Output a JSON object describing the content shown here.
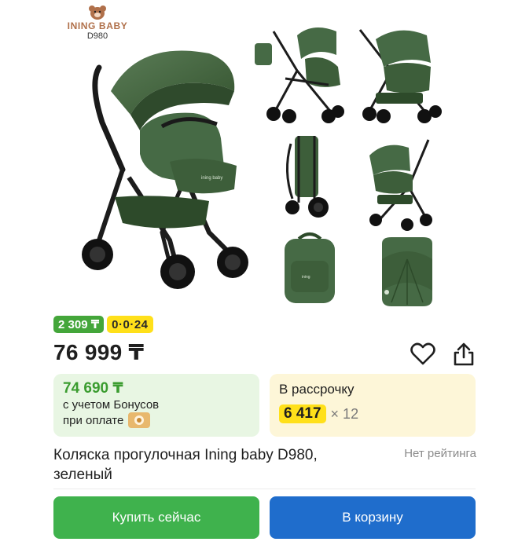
{
  "brand": {
    "name": "INING BABY",
    "model": "D980"
  },
  "gallery": {
    "main_image": "stroller-main-photo",
    "thumbnails": [
      "stroller-with-bag",
      "stroller-reversed-seat",
      "stroller-folded",
      "stroller-bassinet",
      "backpack",
      "footmuff"
    ],
    "product_color": "#466a45"
  },
  "badges": {
    "bonus": "2 309 ₸",
    "installment_plan": "0·0·24"
  },
  "price": {
    "current": "76 999 ₸"
  },
  "bonus_card": {
    "price": "74 690 ₸",
    "line1": "с учетом Бонусов",
    "line2": "при оплате"
  },
  "installment_card": {
    "title": "В рассрочку",
    "amount": "6 417",
    "times": "× 12"
  },
  "product": {
    "title": "Коляска прогулочная Ining baby D980, зеленый",
    "rating": "Нет рейтинга"
  },
  "actions": {
    "buy_now": "Купить сейчас",
    "add_to_cart": "В корзину"
  },
  "colors": {
    "bonus_green": "#44a63a",
    "accent_yellow": "#ffe01a",
    "buy_button": "#3fb24d",
    "cart_button": "#1f6dcc"
  }
}
